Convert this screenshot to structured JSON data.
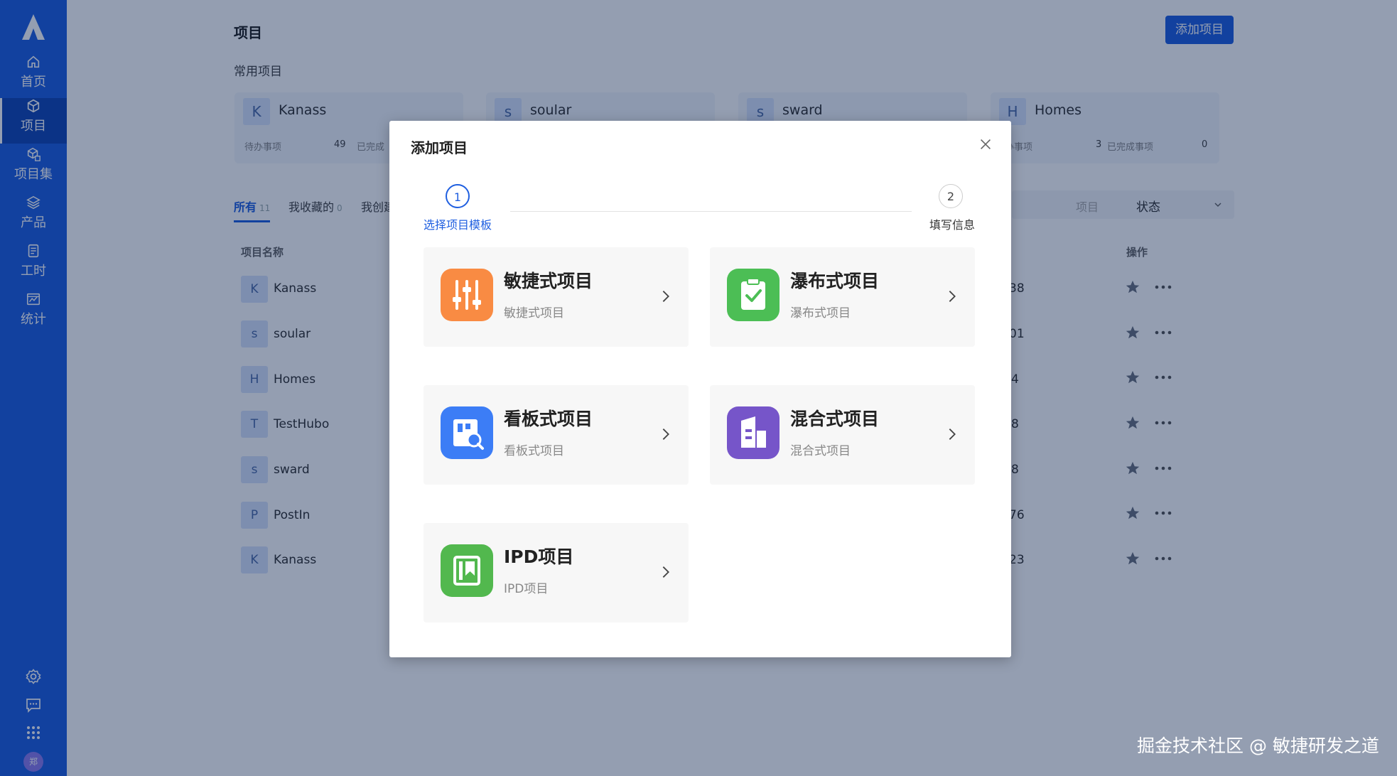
{
  "sidebar": {
    "items": [
      {
        "label": "首页",
        "icon": "home-icon"
      },
      {
        "label": "项目",
        "icon": "cube-icon"
      },
      {
        "label": "项目集",
        "icon": "cube-set-icon"
      },
      {
        "label": "产品",
        "icon": "layers-icon"
      },
      {
        "label": "工时",
        "icon": "document-icon"
      },
      {
        "label": "统计",
        "icon": "chart-icon"
      }
    ],
    "bottom_icons": [
      "gear-icon",
      "message-icon",
      "apps-grid-icon"
    ],
    "avatar_text": "郑"
  },
  "page": {
    "title": "项目",
    "add_button": "添加项目",
    "recent_title": "常用项目",
    "recent_cards": [
      {
        "letter": "K",
        "name": "Kanass",
        "todo_label": "待办事项",
        "todo": "49",
        "done_label": "已完成"
      },
      {
        "letter": "s",
        "name": "soular"
      },
      {
        "letter": "s",
        "name": "sward"
      },
      {
        "letter": "H",
        "name": "Homes",
        "todo_label": "办事项",
        "todo": "3",
        "done_label": "已完成事项",
        "done": "0"
      }
    ],
    "tabs": [
      {
        "label": "所有",
        "count": "11"
      },
      {
        "label": "我收藏的",
        "count": "0"
      },
      {
        "label": "我创建"
      }
    ],
    "search_placeholder": "项目",
    "status_select": "状态",
    "table": {
      "col_name": "项目名称",
      "col_action": "操作",
      "rows": [
        {
          "letter": "K",
          "name": "Kanass",
          "num": "38"
        },
        {
          "letter": "s",
          "name": "soular",
          "num": "01"
        },
        {
          "letter": "H",
          "name": "Homes",
          "num": "4"
        },
        {
          "letter": "T",
          "name": "TestHubo",
          "num": "8"
        },
        {
          "letter": "s",
          "name": "sward",
          "num": "8"
        },
        {
          "letter": "P",
          "name": "PostIn",
          "num": "76"
        },
        {
          "letter": "K",
          "name": "Kanass",
          "num": "23"
        }
      ]
    }
  },
  "modal": {
    "title": "添加项目",
    "steps": [
      {
        "num": "1",
        "label": "选择项目模板"
      },
      {
        "num": "2",
        "label": "填写信息"
      }
    ],
    "templates": [
      {
        "name": "敏捷式项目",
        "desc": "敏捷式项目",
        "icon": "sliders-icon",
        "color": "#f98b43"
      },
      {
        "name": "瀑布式项目",
        "desc": "瀑布式项目",
        "icon": "clipboard-check-icon",
        "color": "#4cbe55"
      },
      {
        "name": "看板式项目",
        "desc": "看板式项目",
        "icon": "kanban-search-icon",
        "color": "#3c7df6"
      },
      {
        "name": "混合式项目",
        "desc": "混合式项目",
        "icon": "building-icon",
        "color": "#7655c9"
      },
      {
        "name": "IPD项目",
        "desc": "IPD项目",
        "icon": "book-icon",
        "color": "#52b84e"
      }
    ]
  },
  "watermark": "掘金技术社区 @ 敏捷研发之道",
  "colors": {
    "primary": "#1f5fe0",
    "overlay": "rgba(0,25,70,0.42)"
  }
}
